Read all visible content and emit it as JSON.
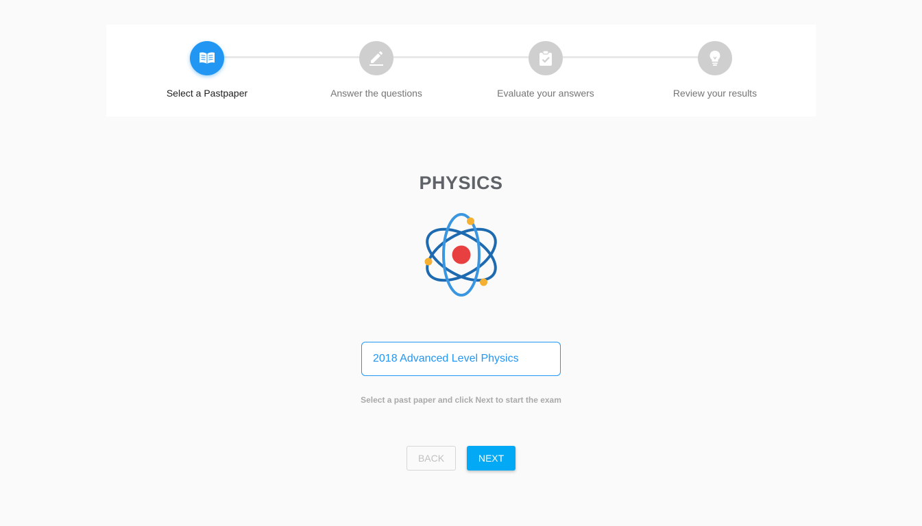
{
  "stepper": {
    "steps": [
      {
        "label": "Select a Pastpaper",
        "icon": "book-open-icon",
        "state": "active"
      },
      {
        "label": "Answer the questions",
        "icon": "pencil-icon",
        "state": "inactive"
      },
      {
        "label": "Evaluate your answers",
        "icon": "clipboard-check-icon",
        "state": "inactive"
      },
      {
        "label": "Review your results",
        "icon": "lightbulb-icon",
        "state": "inactive"
      }
    ]
  },
  "subject": {
    "title": "PHYSICS",
    "icon": "atom-icon"
  },
  "paper_select": {
    "selected_value": "2018 Advanced Level Physics"
  },
  "hint": "Select a past paper and click Next to start the exam",
  "buttons": {
    "back_label": "BACK",
    "next_label": "NEXT"
  },
  "colors": {
    "accent": "#2196f3",
    "next_button": "#03a9f4",
    "inactive_step": "#cfcfcf",
    "atom_orbit_dark": "#1e6ab0",
    "atom_orbit_light": "#3a96e0",
    "atom_nucleus": "#e84040",
    "atom_electron": "#f5b031"
  }
}
